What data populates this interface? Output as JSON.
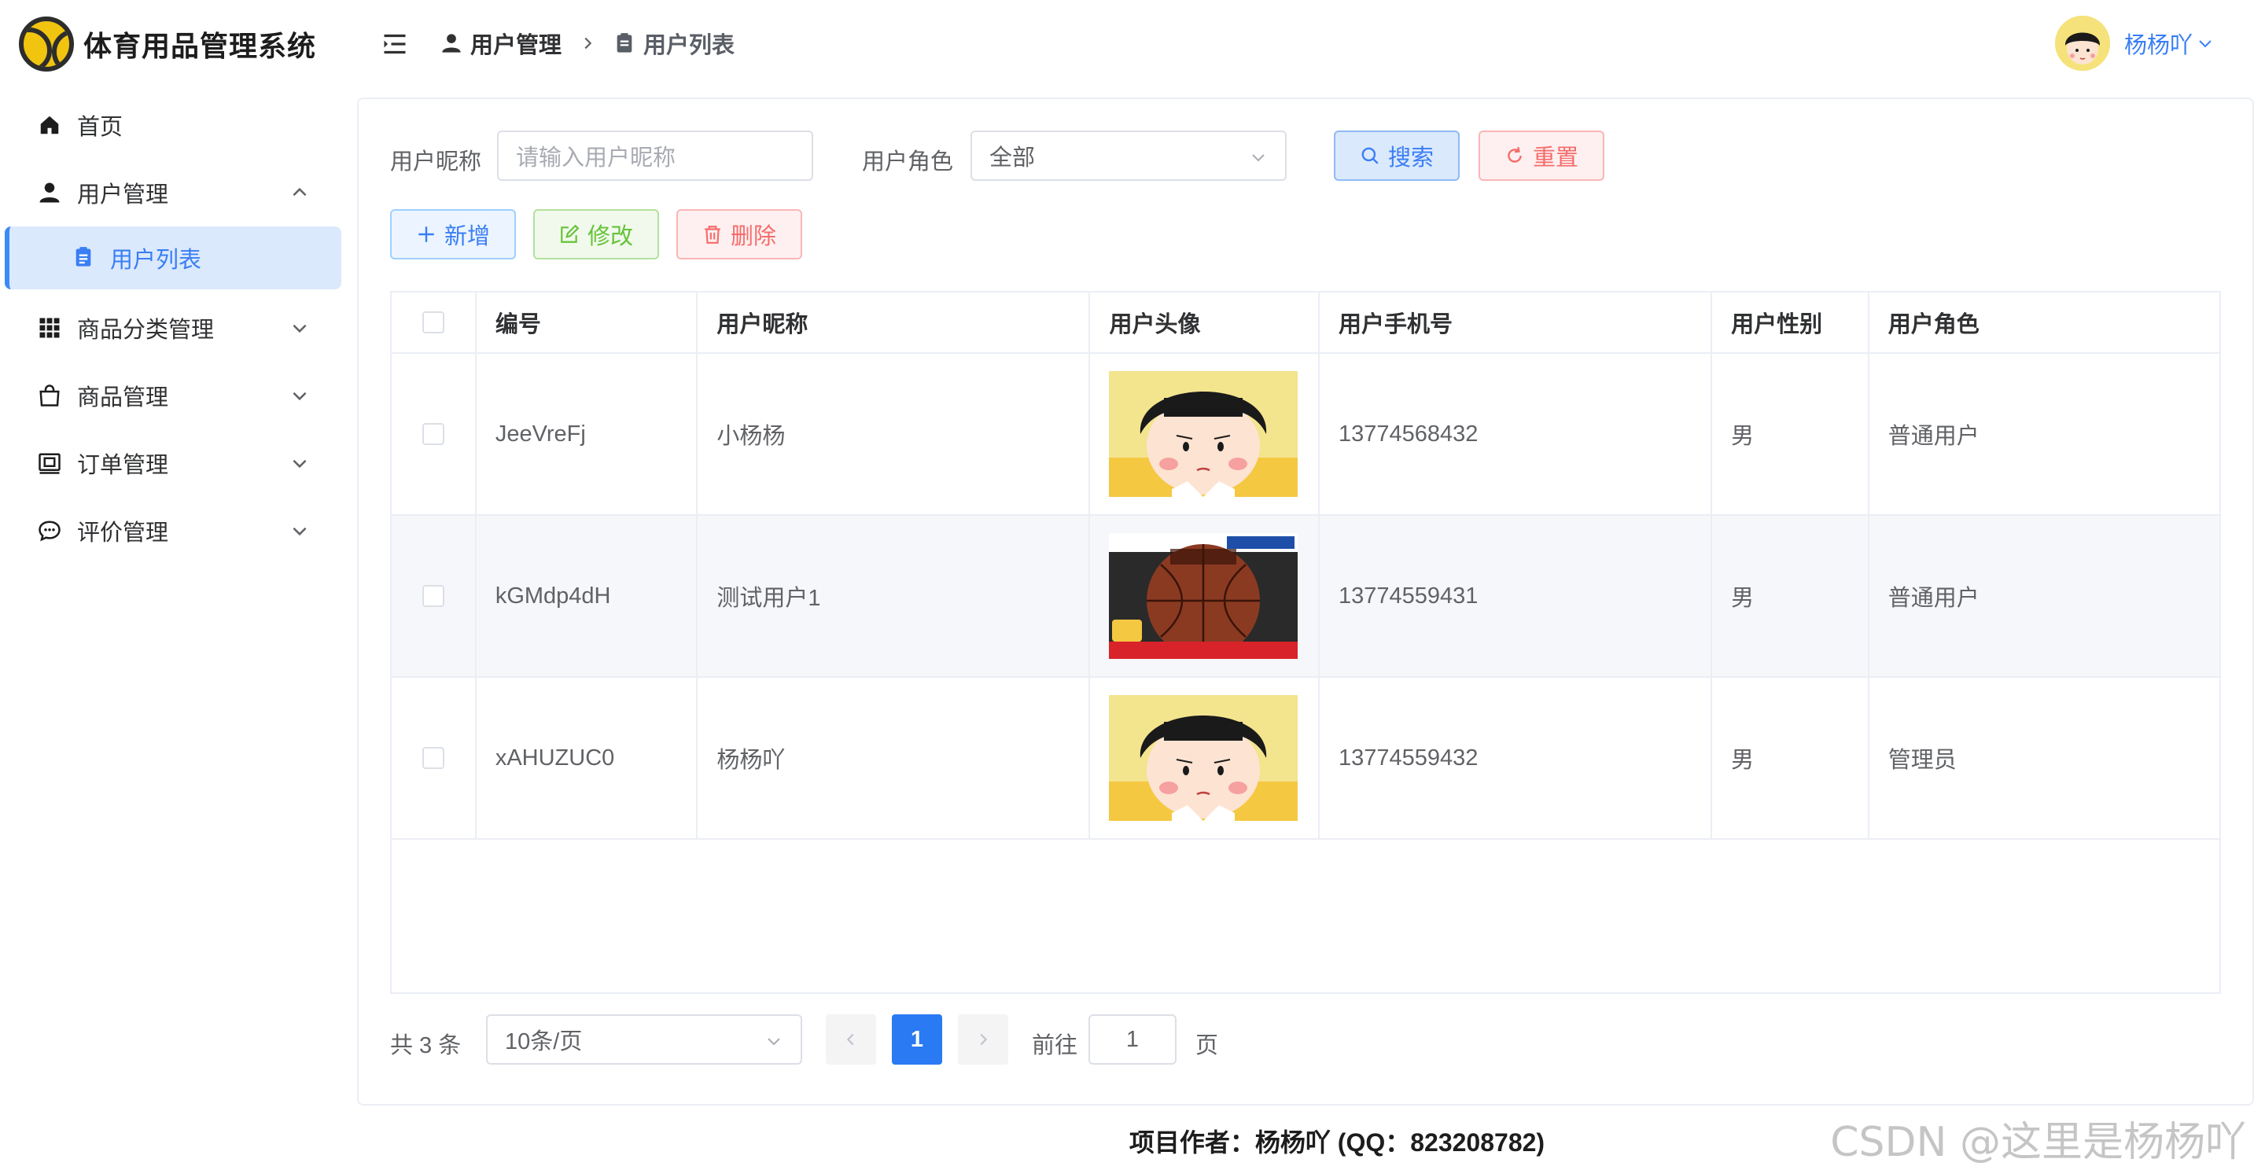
{
  "app": {
    "title": "体育用品管理系统"
  },
  "sidebar": {
    "items": [
      {
        "label": "首页",
        "icon": "home-icon"
      },
      {
        "label": "用户管理",
        "icon": "user-icon",
        "expanded": true
      },
      {
        "label": "用户列表",
        "icon": "clipboard-icon",
        "active": true
      },
      {
        "label": "商品分类管理",
        "icon": "grid-icon"
      },
      {
        "label": "商品管理",
        "icon": "bag-icon"
      },
      {
        "label": "订单管理",
        "icon": "wallet-icon"
      },
      {
        "label": "评价管理",
        "icon": "chat-icon"
      }
    ]
  },
  "header": {
    "breadcrumb": [
      "用户管理",
      "用户列表"
    ],
    "username": "杨杨吖"
  },
  "filters": {
    "nickname_label": "用户昵称",
    "nickname_placeholder": "请输入用户昵称",
    "role_label": "用户角色",
    "role_value": "全部",
    "search_label": "搜索",
    "reset_label": "重置"
  },
  "toolbar": {
    "add_label": "新增",
    "edit_label": "修改",
    "delete_label": "删除"
  },
  "table": {
    "columns": [
      "编号",
      "用户昵称",
      "用户头像",
      "用户手机号",
      "用户性别",
      "用户角色"
    ],
    "rows": [
      {
        "id": "JeeVreFj",
        "nickname": "小杨杨",
        "avatar": "cartoon-girl-avatar",
        "phone": "13774568432",
        "gender": "男",
        "role": "普通用户"
      },
      {
        "id": "kGMdp4dH",
        "nickname": "测试用户1",
        "avatar": "basketball-image",
        "phone": "13774559431",
        "gender": "男",
        "role": "普通用户"
      },
      {
        "id": "xAHUZUC0",
        "nickname": "杨杨吖",
        "avatar": "cartoon-girl-avatar",
        "phone": "13774559432",
        "gender": "男",
        "role": "管理员"
      }
    ]
  },
  "pagination": {
    "total_text": "共 3 条",
    "page_size": "10条/页",
    "current_page": "1",
    "goto_label": "前往",
    "goto_value": "1",
    "page_suffix": "页"
  },
  "footer": {
    "text": "项目作者：杨杨吖 (QQ：823208782)"
  },
  "watermark": "CSDN @这里是杨杨吖",
  "colors": {
    "accent": "#2a7af3",
    "danger": "#f56c6c",
    "success": "#67c23a",
    "active_bg": "#dbe9fd"
  }
}
